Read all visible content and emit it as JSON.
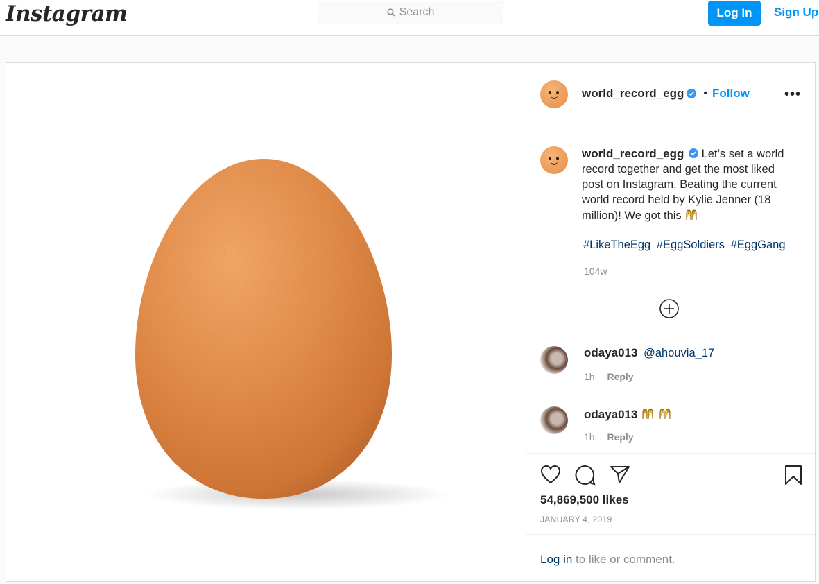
{
  "topbar": {
    "logo": "Instagram",
    "search_placeholder": "Search",
    "login_label": "Log In",
    "signup_label": "Sign Up"
  },
  "post": {
    "username": "world_record_egg",
    "separator": "•",
    "follow_label": "Follow",
    "more_label": "•••",
    "caption": "Let’s set a world record together and get the most liked post on Instagram. Beating the current world record held by Kylie Jenner (18 million)! We got this",
    "hashtags": [
      "#LikeTheEgg",
      "#EggSoldiers",
      "#EggGang"
    ],
    "age": "104w",
    "comments": [
      {
        "user": "odaya013",
        "mention": "@ahouvia_17",
        "time": "1h",
        "reply_label": "Reply"
      },
      {
        "user": "odaya013",
        "mention": "",
        "time": "1h",
        "reply_label": "Reply"
      }
    ],
    "likes": "54,869,500 likes",
    "date": "JANUARY 4, 2019",
    "footer_link": "Log in",
    "footer_text": " to like or comment."
  },
  "icons": [
    "search-icon",
    "verified-icon",
    "more-options-icon",
    "load-more-icon",
    "heart-icon",
    "comment-icon",
    "share-icon",
    "bookmark-icon",
    "raised-hands-emoji"
  ],
  "colors": {
    "accent": "#0095f6",
    "link": "#00376b",
    "muted": "#8e8e8e",
    "egg": "#e08a4a"
  }
}
